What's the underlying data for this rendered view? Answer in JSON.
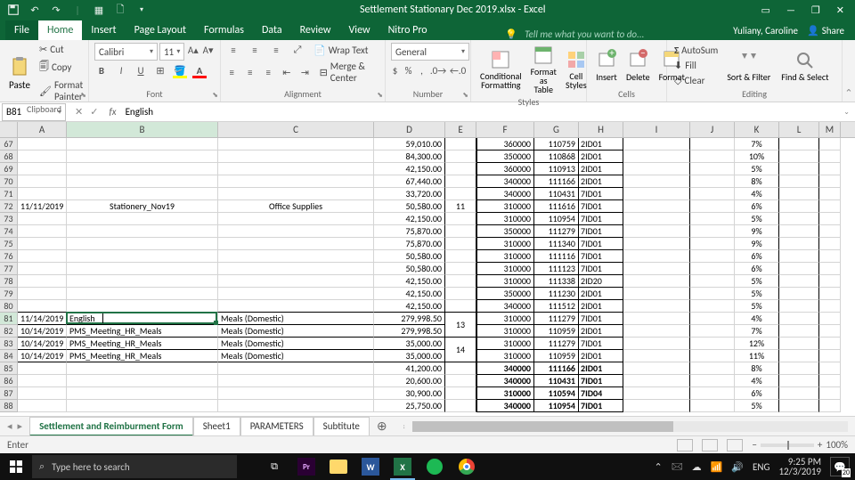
{
  "title": "Settlement Stationary Dec 2019.xlsx - Excel",
  "user": "Yuliany, Caroline",
  "share": "Share",
  "tabs": [
    "File",
    "Home",
    "Insert",
    "Page Layout",
    "Formulas",
    "Data",
    "Review",
    "View",
    "Nitro Pro"
  ],
  "tellme": "Tell me what you want to do...",
  "clipboard": {
    "label": "Clipboard",
    "paste": "Paste",
    "cut": "Cut",
    "copy": "Copy",
    "fp": "Format Painter"
  },
  "font": {
    "label": "Font",
    "name": "Calibri",
    "size": "11"
  },
  "alignment": {
    "label": "Alignment",
    "wrap": "Wrap Text",
    "merge": "Merge & Center"
  },
  "number": {
    "label": "Number",
    "format": "General"
  },
  "styles": {
    "label": "Styles",
    "cf": "Conditional\nFormatting",
    "ft": "Format as\nTable",
    "cs": "Cell\nStyles"
  },
  "cells": {
    "label": "Cells",
    "insert": "Insert",
    "delete": "Delete",
    "format": "Format"
  },
  "editing": {
    "label": "Editing",
    "autosum": "AutoSum",
    "fill": "Fill",
    "clear": "Clear",
    "sort": "Sort &\nFilter",
    "find": "Find &\nSelect"
  },
  "namebox": "B81",
  "formula": "English",
  "cols": {
    "A": 55,
    "B": 170,
    "C": 175,
    "D": 80,
    "E": 35,
    "F": 65,
    "G": 50,
    "H": 50,
    "I": 75,
    "J": 50,
    "K": 50,
    "L": 45,
    "M": 24
  },
  "rows": [
    {
      "n": 67,
      "D": "59,010.00",
      "F": "360000",
      "G": "110759",
      "H": "2ID01",
      "K": "7%"
    },
    {
      "n": 68,
      "D": "84,300.00",
      "F": "350000",
      "G": "110868",
      "H": "2ID01",
      "K": "10%"
    },
    {
      "n": 69,
      "D": "42,150.00",
      "F": "360000",
      "G": "110913",
      "H": "2ID01",
      "K": "5%"
    },
    {
      "n": 70,
      "D": "67,440.00",
      "F": "340000",
      "G": "111166",
      "H": "2ID01",
      "K": "8%"
    },
    {
      "n": 71,
      "D": "33,720.00",
      "F": "340000",
      "G": "110431",
      "H": "7ID01",
      "K": "4%"
    },
    {
      "n": 72,
      "A": "11/11/2019",
      "B": "Stationery_Nov19",
      "C": "Office Supplies",
      "D": "50,580.00",
      "E": "11",
      "F": "310000",
      "G": "111616",
      "H": "7ID01",
      "K": "6%"
    },
    {
      "n": 73,
      "D": "42,150.00",
      "F": "310000",
      "G": "110954",
      "H": "7ID01",
      "K": "5%"
    },
    {
      "n": 74,
      "D": "75,870.00",
      "F": "350000",
      "G": "111279",
      "H": "7ID01",
      "K": "9%"
    },
    {
      "n": 75,
      "D": "75,870.00",
      "F": "310000",
      "G": "111340",
      "H": "7ID01",
      "K": "9%"
    },
    {
      "n": 76,
      "D": "50,580.00",
      "F": "310000",
      "G": "111116",
      "H": "7ID01",
      "K": "6%"
    },
    {
      "n": 77,
      "D": "50,580.00",
      "F": "310000",
      "G": "111123",
      "H": "7ID01",
      "K": "6%"
    },
    {
      "n": 78,
      "D": "42,150.00",
      "F": "310000",
      "G": "111338",
      "H": "2ID20",
      "K": "5%"
    },
    {
      "n": 79,
      "D": "42,150.00",
      "F": "350000",
      "G": "111230",
      "H": "2ID01",
      "K": "5%"
    },
    {
      "n": 80,
      "D": "42,150.00",
      "F": "340000",
      "G": "111512",
      "H": "2ID01",
      "K": "5%",
      "blockBottom": true
    },
    {
      "n": 81,
      "A": "11/14/2019",
      "B": "English",
      "C": "Meals (Domestic)",
      "D": "279,998.50",
      "E": "13",
      "F": "310000",
      "G": "111279",
      "H": "7ID01",
      "K": "4%",
      "active": true,
      "mergeE": 2
    },
    {
      "n": 82,
      "A": "10/14/2019",
      "B": "PMS_Meeting_HR_Meals",
      "C": "Meals (Domestic)",
      "D": "279,998.50",
      "F": "310000",
      "G": "110959",
      "H": "2ID01",
      "K": "7%"
    },
    {
      "n": 83,
      "A": "10/14/2019",
      "B": "PMS_Meeting_HR_Meals",
      "C": "Meals (Domestic)",
      "D": "35,000.00",
      "E": "14",
      "F": "310000",
      "G": "111279",
      "H": "7ID01",
      "K": "12%",
      "mergeE": 2
    },
    {
      "n": 84,
      "A": "10/14/2019",
      "B": "PMS_Meeting_HR_Meals",
      "C": "Meals (Domestic)",
      "D": "35,000.00",
      "F": "310000",
      "G": "110959",
      "H": "2ID01",
      "K": "11%"
    },
    {
      "n": 85,
      "D": "41,200.00",
      "F": "340000",
      "G": "111166",
      "H": "2ID01",
      "K": "8%",
      "boldFGH": true
    },
    {
      "n": 86,
      "D": "20,600.00",
      "F": "340000",
      "G": "110431",
      "H": "7ID01",
      "K": "4%",
      "boldFGH": true
    },
    {
      "n": 87,
      "D": "30,900.00",
      "F": "310000",
      "G": "110594",
      "H": "7ID04",
      "K": "6%",
      "boldFGH": true
    },
    {
      "n": 88,
      "D": "25,750.00",
      "F": "340000",
      "G": "110954",
      "H": "7ID01",
      "K": "5%",
      "boldFGH": true
    }
  ],
  "sheets": [
    "Settlement and Reimburment Form",
    "Sheet1",
    "PARAMETERS",
    "Subtitute"
  ],
  "status": "Enter",
  "zoom": "100%",
  "taskbar": {
    "search": "Type here to search",
    "time": "9:25 PM",
    "date": "12/3/2019",
    "lang": "ENG",
    "notif": "20"
  }
}
